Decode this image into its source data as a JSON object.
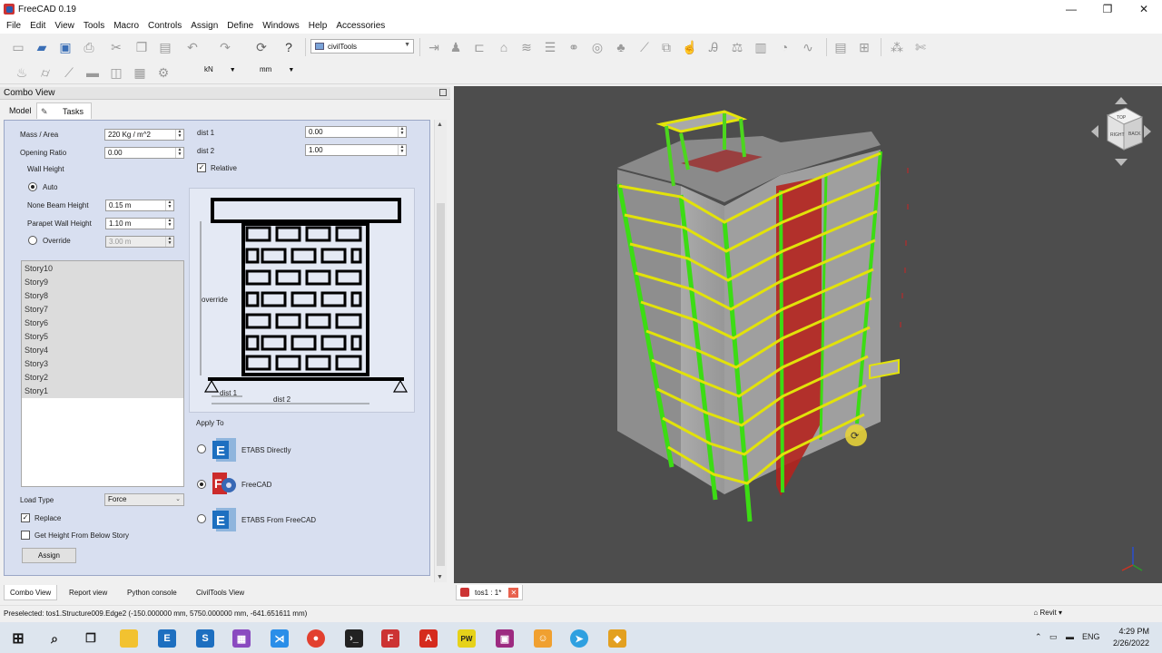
{
  "window": {
    "title": "FreeCAD 0.19",
    "minimize": "—",
    "maximize": "❐",
    "close": "✕"
  },
  "menu": [
    "File",
    "Edit",
    "View",
    "Tools",
    "Macro",
    "Controls",
    "Assign",
    "Define",
    "Windows",
    "Help",
    "Accessories"
  ],
  "toolbar": {
    "workbench": "civilTools",
    "force_unit": "kN",
    "length_unit": "mm",
    "icons1": [
      "new-icon",
      "open-icon",
      "save-icon",
      "print-icon",
      "cut-icon",
      "copy-icon",
      "paste-icon",
      "undo-icon",
      "redo-icon",
      "refresh-icon",
      "whats-this-icon"
    ],
    "icons2": [
      "arrow-icon",
      "people-icon",
      "bracket-icon",
      "shape-icon",
      "spring-icon",
      "stack-icon",
      "link-icon",
      "spiral-icon",
      "spiral-icon",
      "tree-icon",
      "ruler-icon",
      "piping-icon",
      "hand-icon",
      "symbol-icon",
      "balance-icon",
      "chart-icon",
      "gauge-icon",
      "signal-icon",
      "waveform-icon",
      "list-icon",
      "grid-icon",
      "node-icon",
      "scissors-icon"
    ],
    "icons3": [
      "wall-icon",
      "cylinder-icon",
      "beam-icon",
      "column-icon",
      "frame-icon",
      "table-icon",
      "settings-icon"
    ]
  },
  "combo": {
    "header": "Combo View",
    "tabs": [
      "Model",
      "Tasks"
    ],
    "fields": {
      "mass_label": "Mass / Area",
      "mass_value": "220 Kg / m^2",
      "opening_label": "Opening Ratio",
      "opening_value": "0.00",
      "wall_height_label": "Wall Height",
      "auto_label": "Auto",
      "none_beam_label": "None Beam Height",
      "none_beam_value": "0.15 m",
      "parapet_label": "Parapet Wall Height",
      "parapet_value": "1.10 m",
      "override_label": "Override",
      "override_value": "3.00 m",
      "dist1_label": "dist 1",
      "dist1_value": "0.00",
      "dist2_label": "dist 2",
      "dist2_value": "1.00",
      "relative_label": "Relative"
    },
    "stories": [
      "Story10",
      "Story9",
      "Story8",
      "Story7",
      "Story6",
      "Story5",
      "Story4",
      "Story3",
      "Story2",
      "Story1"
    ],
    "load_type_label": "Load Type",
    "load_type_value": "Force",
    "replace_label": "Replace",
    "get_height_label": "Get Height From Below Story",
    "assign_label": "Assign",
    "diagram": {
      "override": "override",
      "dist1": "dist 1",
      "dist2": "dist 2"
    },
    "apply_to_label": "Apply To",
    "apply_options": [
      "ETABS Directly",
      "FreeCAD",
      "ETABS From FreeCAD"
    ],
    "apply_selected": "FreeCAD"
  },
  "bottom_tabs": [
    "Combo View",
    "Report view",
    "Python console",
    "CivilTools View"
  ],
  "doc_tab": "tos1 : 1*",
  "status": "Preselected: tos1.Structure009.Edge2 (-150.000000 mm, 5750.000000 mm, -641.651611 mm)",
  "nav_style": "Revit",
  "nav_cube": {
    "face1": "RIGHT",
    "face2": "TOP",
    "face3": "BACK"
  },
  "taskbar": {
    "icons": [
      "windows-icon",
      "search-icon",
      "task-view-icon",
      "file-explorer-icon",
      "etabs-icon",
      "safe-icon",
      "app-icon",
      "vscode-icon",
      "chrome-icon",
      "terminal-icon",
      "freecad-icon",
      "acrobat-icon",
      "pw-icon",
      "app2-icon",
      "user-icon",
      "telegram-icon",
      "app3-icon"
    ],
    "lang": "ENG",
    "time": "4:29 PM",
    "date": "2/26/2022"
  }
}
